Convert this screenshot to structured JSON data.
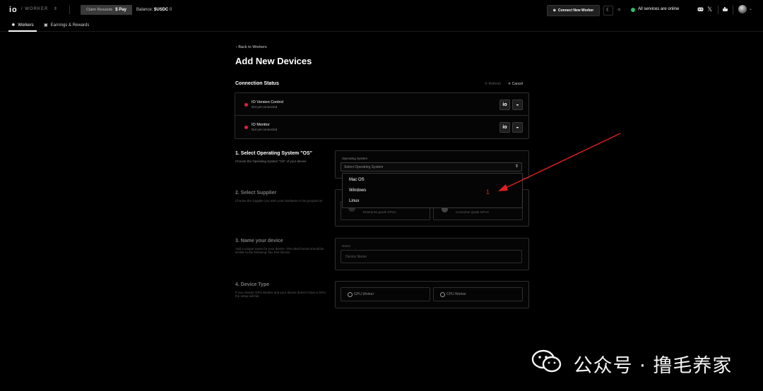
{
  "header": {
    "logo": "io",
    "product": "/ WORKER",
    "claim_label": "Claim Rewards",
    "claim_pay": "$ Pay",
    "balance_label": "Balance",
    "balance_currency": "$USDC",
    "balance_value": "0",
    "connect_label": "Connect New Worker",
    "status_text": "All services are online",
    "status_color": "#26c26b"
  },
  "tabs": [
    {
      "label": "Workers",
      "active": true
    },
    {
      "label": "Earnings & Rewards",
      "active": false
    }
  ],
  "page": {
    "back_link": "Back to Workers",
    "title": "Add New Devices"
  },
  "connection": {
    "heading": "Connection Status",
    "refresh_label": "Refresh",
    "cancel_label": "Cancel",
    "rows": [
      {
        "name": "IO Version Control",
        "status": "Not yet connected"
      },
      {
        "name": "IO Monitor",
        "status": "Not yet connected"
      }
    ]
  },
  "step1": {
    "title": "1. Select Operating System \"OS\"",
    "desc": "Choose the Operating System \"OS\" of your device",
    "field_label": "Operating System",
    "placeholder": "Select Operating System",
    "options": [
      "Mac OS",
      "Windows",
      "Linux"
    ]
  },
  "step2": {
    "title": "2. Select Supplier",
    "desc": "Choose the supplier you wish your hardware to be grouped at",
    "card1_sub": "Enterprise grade GPUs",
    "card2_sub": "Consumer grade GPUs"
  },
  "step3": {
    "title": "3. Name your device",
    "desc_line1": "Add a unique name for your device. The ideal format should be",
    "desc_line2": "similar to the following: Mu Test Device",
    "field_label": "Name",
    "placeholder": "Device Name"
  },
  "step4": {
    "title": "4. Device Type",
    "desc_line1": "If you choose GPU Worker and your device doesn't have a GPU",
    "desc_line2": "the setup will fail.",
    "options": [
      "GPU Worker",
      "CPU Worker"
    ]
  },
  "annotation": {
    "marker": "1",
    "color": "#e02020"
  },
  "watermark": {
    "text": "公众号 · 撸毛养家"
  }
}
